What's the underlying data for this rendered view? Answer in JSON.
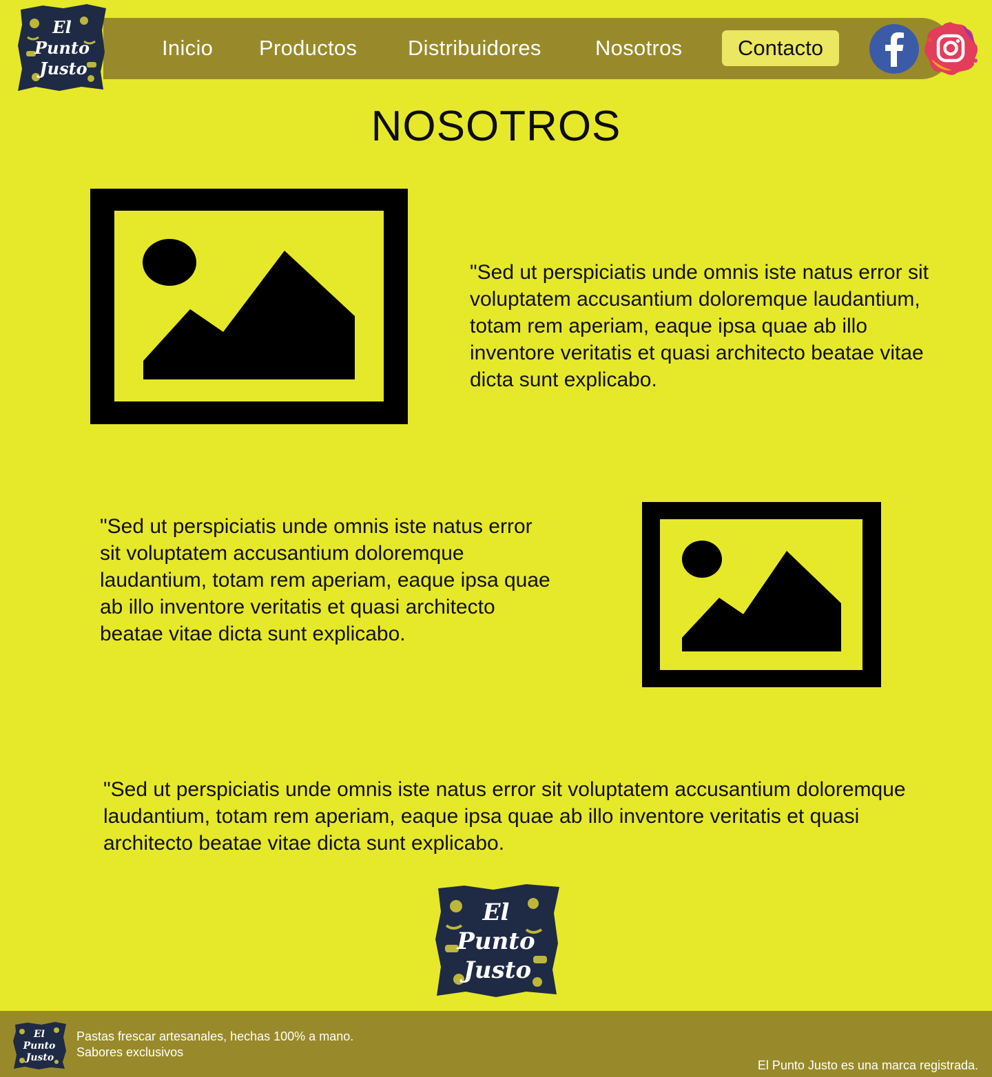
{
  "nav": {
    "items": [
      "Inicio",
      "Productos",
      "Distribuidores",
      "Nosotros"
    ],
    "contact_label": "Contacto"
  },
  "brand": {
    "logo_text_line1": "El",
    "logo_text_line2": "Punto",
    "logo_text_line3": "Justo"
  },
  "social": {
    "facebook_icon": "facebook-icon",
    "instagram_icon": "instagram-icon"
  },
  "main": {
    "title": "NOSOTROS",
    "paragraph_1": "\"Sed ut perspiciatis unde omnis iste natus error sit voluptatem accusantium doloremque laudantium, totam rem aperiam, eaque ipsa quae ab illo inventore veritatis et quasi architecto beatae vitae dicta sunt explicabo.",
    "paragraph_2": "\"Sed ut perspiciatis unde omnis iste natus error sit voluptatem accusantium doloremque laudantium, totam rem aperiam, eaque ipsa quae ab illo inventore veritatis et quasi architecto beatae vitae dicta sunt explicabo.",
    "paragraph_3": "\"Sed ut perspiciatis unde omnis iste natus error sit voluptatem accusantium doloremque laudantium, totam rem aperiam, eaque ipsa quae ab illo inventore veritatis et quasi architecto beatae vitae dicta sunt explicabo."
  },
  "footer": {
    "tagline_1": "Pastas frescar artesanales, hechas 100% a mano.",
    "tagline_2": "Sabores exclusivos",
    "legal": "El Punto Justo es una marca registrada."
  },
  "colors": {
    "background": "#e6e82a",
    "bar": "#988a2b",
    "contact_button": "#ebe760",
    "logo_navy": "#1f2a44"
  }
}
